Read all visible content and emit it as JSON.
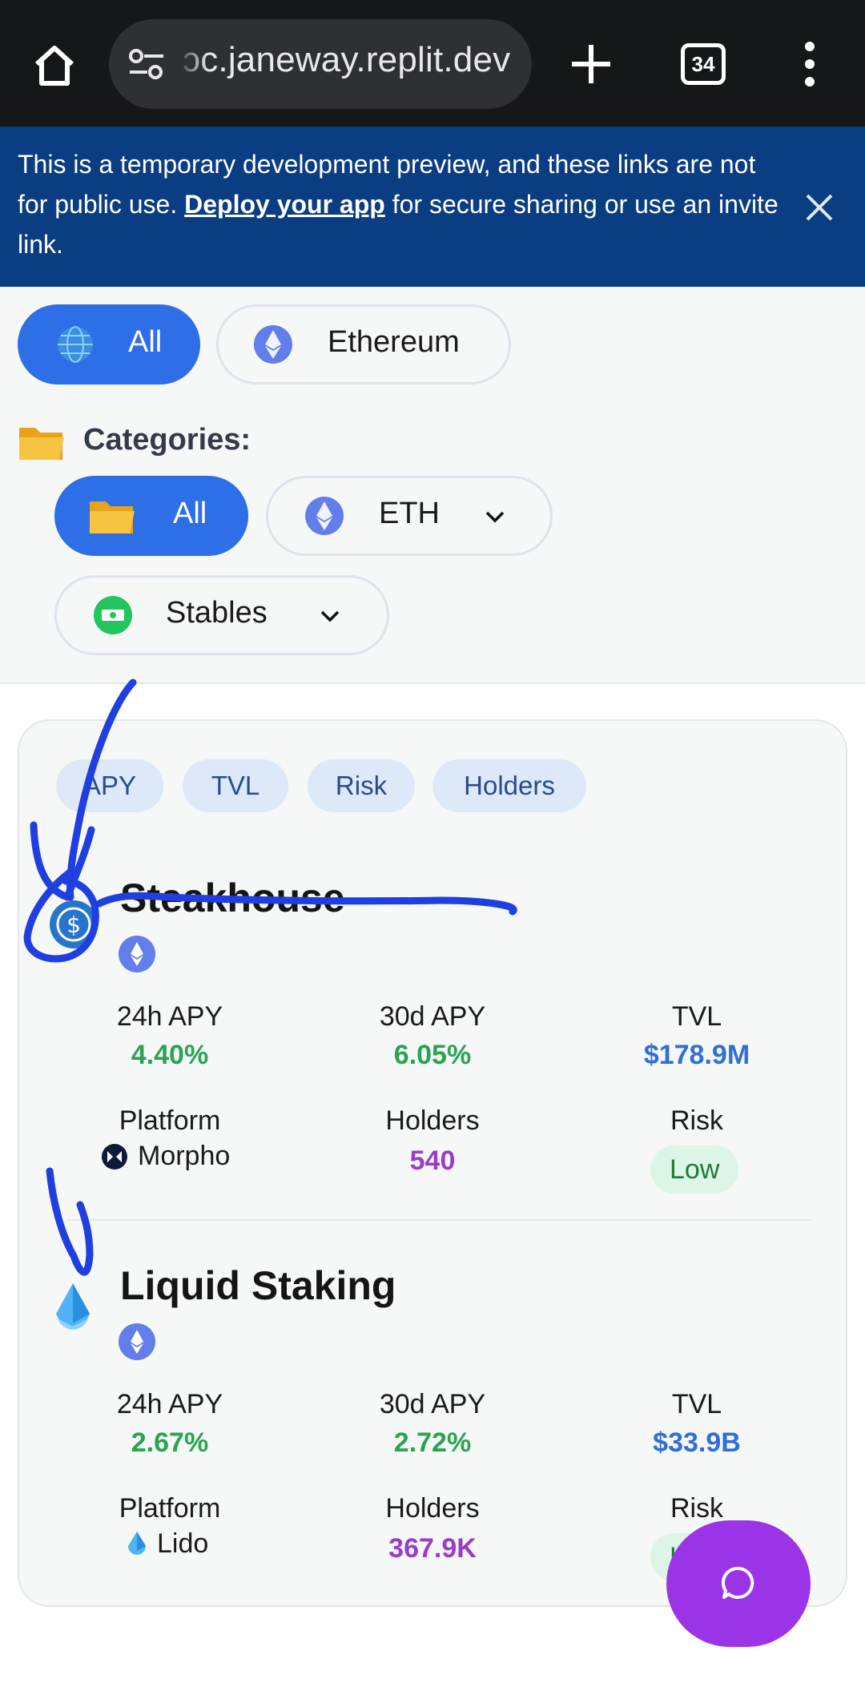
{
  "browser": {
    "url_fragment": "ɔc.janeway.replit.dev",
    "tab_count": "34",
    "icons": [
      "home-icon",
      "tune-icon",
      "plus-icon",
      "tabs-icon",
      "more-vert-icon"
    ]
  },
  "banner": {
    "text_before": "This is a temporary development preview, and these links are not for public use. ",
    "link": "Deploy your app",
    "text_after": " for secure sharing or use an invite link.",
    "bg_color": "#0b3d82"
  },
  "networks": {
    "all_label": "All",
    "ethereum_label": "Ethereum"
  },
  "categories": {
    "title": "Categories:",
    "all_label": "All",
    "eth_label": "ETH",
    "stables_label": "Stables"
  },
  "sort": {
    "apy": "APY",
    "tvl": "TVL",
    "risk": "Risk",
    "holders": "Holders"
  },
  "pools": [
    {
      "name": "Steakhouse",
      "apy24_label": "24h APY",
      "apy24": "4.40%",
      "apy30_label": "30d APY",
      "apy30": "6.05%",
      "tvl_label": "TVL",
      "tvl": "$178.9M",
      "platform_label": "Platform",
      "platform": "Morpho",
      "holders_label": "Holders",
      "holders": "540",
      "risk_label": "Risk",
      "risk": "Low"
    },
    {
      "name": "Liquid Staking",
      "apy24_label": "24h APY",
      "apy24": "2.67%",
      "apy30_label": "30d APY",
      "apy30": "2.72%",
      "tvl_label": "TVL",
      "tvl": "$33.9B",
      "platform_label": "Platform",
      "platform": "Lido",
      "holders_label": "Holders",
      "holders": "367.9K",
      "risk_label": "Risk",
      "risk": "Low"
    }
  ],
  "colors": {
    "accent": "#2e6ee6",
    "positive": "#2aa352",
    "tvl": "#2f6fd6",
    "holders": "#9b3cc7",
    "fab": "#9a34e6",
    "annotation": "#1f3fe0"
  }
}
